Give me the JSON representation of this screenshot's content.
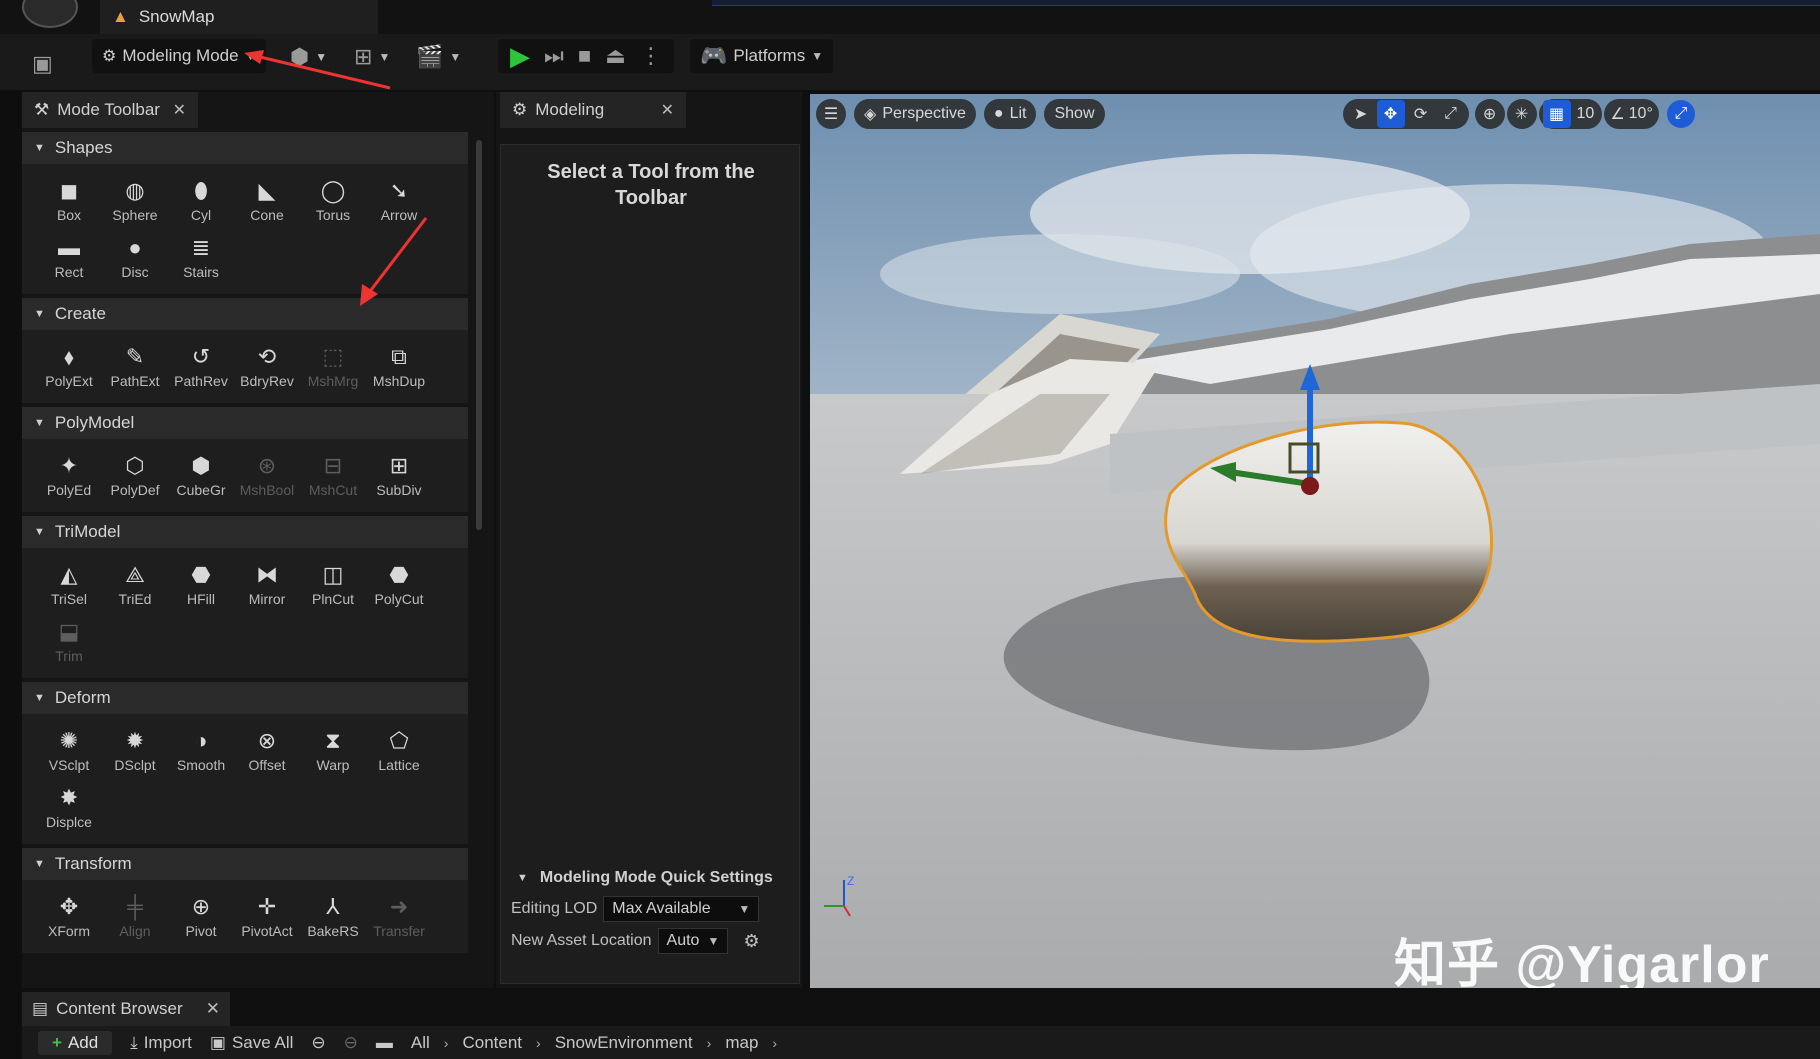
{
  "titlebar": {
    "doc_tab": "SnowMap"
  },
  "toolbar": {
    "mode_label": "Modeling Mode",
    "platforms_label": "Platforms"
  },
  "mode_toolbar_tab": {
    "label": "Mode Toolbar"
  },
  "modeling_tab": {
    "label": "Modeling"
  },
  "sections": [
    {
      "title": "Shapes",
      "tools": [
        {
          "label": "Box",
          "icon": "box-icon",
          "disabled": false
        },
        {
          "label": "Sphere",
          "icon": "sphere-icon",
          "disabled": false
        },
        {
          "label": "Cyl",
          "icon": "cylinder-icon",
          "disabled": false
        },
        {
          "label": "Cone",
          "icon": "cone-icon",
          "disabled": false
        },
        {
          "label": "Torus",
          "icon": "torus-icon",
          "disabled": false
        },
        {
          "label": "Arrow",
          "icon": "arrow-icon",
          "disabled": false
        },
        {
          "label": "Rect",
          "icon": "rect-icon",
          "disabled": false
        },
        {
          "label": "Disc",
          "icon": "disc-icon",
          "disabled": false
        },
        {
          "label": "Stairs",
          "icon": "stairs-icon",
          "disabled": false
        }
      ]
    },
    {
      "title": "Create",
      "tools": [
        {
          "label": "PolyExt",
          "icon": "polyext-icon",
          "disabled": false
        },
        {
          "label": "PathExt",
          "icon": "pathext-icon",
          "disabled": false
        },
        {
          "label": "PathRev",
          "icon": "pathrev-icon",
          "disabled": false
        },
        {
          "label": "BdryRev",
          "icon": "bdryrev-icon",
          "disabled": false
        },
        {
          "label": "MshMrg",
          "icon": "mshmrg-icon",
          "disabled": true
        },
        {
          "label": "MshDup",
          "icon": "mshdup-icon",
          "disabled": false
        }
      ]
    },
    {
      "title": "PolyModel",
      "tools": [
        {
          "label": "PolyEd",
          "icon": "polyed-icon",
          "disabled": false
        },
        {
          "label": "PolyDef",
          "icon": "polydef-icon",
          "disabled": false
        },
        {
          "label": "CubeGr",
          "icon": "cubegr-icon",
          "disabled": false
        },
        {
          "label": "MshBool",
          "icon": "mshbool-icon",
          "disabled": true
        },
        {
          "label": "MshCut",
          "icon": "mshcut-icon",
          "disabled": true
        },
        {
          "label": "SubDiv",
          "icon": "subdiv-icon",
          "disabled": false
        }
      ]
    },
    {
      "title": "TriModel",
      "tools": [
        {
          "label": "TriSel",
          "icon": "trisel-icon",
          "disabled": false
        },
        {
          "label": "TriEd",
          "icon": "tried-icon",
          "disabled": false
        },
        {
          "label": "HFill",
          "icon": "hfill-icon",
          "disabled": false
        },
        {
          "label": "Mirror",
          "icon": "mirror-icon",
          "disabled": false
        },
        {
          "label": "PlnCut",
          "icon": "plncut-icon",
          "disabled": false
        },
        {
          "label": "PolyCut",
          "icon": "polycut-icon",
          "disabled": false
        },
        {
          "label": "Trim",
          "icon": "trim-icon",
          "disabled": true
        }
      ]
    },
    {
      "title": "Deform",
      "tools": [
        {
          "label": "VSclpt",
          "icon": "vsclpt-icon",
          "disabled": false
        },
        {
          "label": "DSclpt",
          "icon": "dsclpt-icon",
          "disabled": false
        },
        {
          "label": "Smooth",
          "icon": "smooth-icon",
          "disabled": false
        },
        {
          "label": "Offset",
          "icon": "offset-icon",
          "disabled": false
        },
        {
          "label": "Warp",
          "icon": "warp-icon",
          "disabled": false
        },
        {
          "label": "Lattice",
          "icon": "lattice-icon",
          "disabled": false
        },
        {
          "label": "Displce",
          "icon": "displace-icon",
          "disabled": false
        }
      ]
    },
    {
      "title": "Transform",
      "tools": [
        {
          "label": "XForm",
          "icon": "xform-icon",
          "disabled": false
        },
        {
          "label": "Align",
          "icon": "align-icon",
          "disabled": true
        },
        {
          "label": "Pivot",
          "icon": "pivot-icon",
          "disabled": false
        },
        {
          "label": "PivotAct",
          "icon": "pivotact-icon",
          "disabled": false
        },
        {
          "label": "BakeRS",
          "icon": "bakers-icon",
          "disabled": false
        },
        {
          "label": "Transfer",
          "icon": "transfer-icon",
          "disabled": true
        }
      ]
    }
  ],
  "modeling_panel": {
    "select_message": "Select a Tool from the Toolbar",
    "quick_settings_title": "Modeling Mode Quick Settings",
    "editing_lod_label": "Editing LOD",
    "editing_lod_value": "Max Available",
    "new_asset_location_label": "New Asset Location",
    "new_asset_location_value": "Auto"
  },
  "viewport": {
    "perspective": "Perspective",
    "lit": "Lit",
    "show": "Show",
    "grid_snap": "10",
    "rot_snap": "10°",
    "axis_z": "Z",
    "watermark": "知乎 @Yigarlor"
  },
  "content_browser": {
    "tab_label": "Content Browser",
    "add": "Add",
    "import": "Import",
    "save_all": "Save All",
    "breadcrumbs": [
      "All",
      "Content",
      "SnowEnvironment",
      "map"
    ]
  }
}
